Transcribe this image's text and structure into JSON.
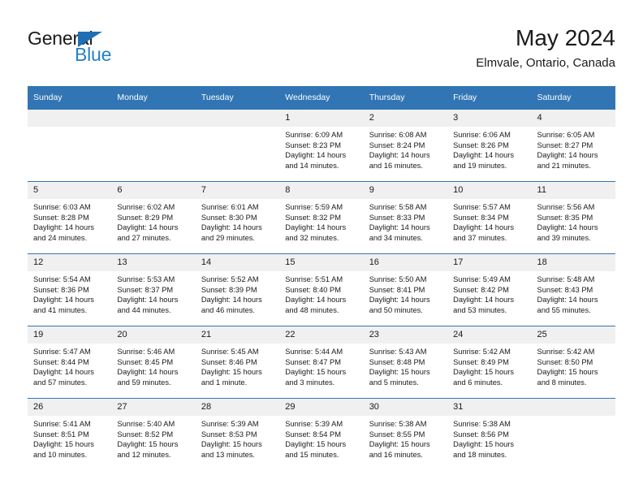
{
  "brand": {
    "name_top": "General",
    "name_bottom": "Blue",
    "accent_color": "#2480c8",
    "triangle_color": "#1f6fb5"
  },
  "header": {
    "title": "May 2024",
    "subtitle": "Elmvale, Ontario, Canada"
  },
  "calendar": {
    "header_bg": "#3175b4",
    "daynum_bg": "#f0f0f0",
    "weekday_headers": [
      "Sunday",
      "Monday",
      "Tuesday",
      "Wednesday",
      "Thursday",
      "Friday",
      "Saturday"
    ],
    "weeks": [
      [
        {
          "empty": true
        },
        {
          "empty": true
        },
        {
          "empty": true
        },
        {
          "day": "1",
          "sunrise": "Sunrise: 6:09 AM",
          "sunset": "Sunset: 8:23 PM",
          "daylight_line1": "Daylight: 14 hours",
          "daylight_line2": "and 14 minutes."
        },
        {
          "day": "2",
          "sunrise": "Sunrise: 6:08 AM",
          "sunset": "Sunset: 8:24 PM",
          "daylight_line1": "Daylight: 14 hours",
          "daylight_line2": "and 16 minutes."
        },
        {
          "day": "3",
          "sunrise": "Sunrise: 6:06 AM",
          "sunset": "Sunset: 8:26 PM",
          "daylight_line1": "Daylight: 14 hours",
          "daylight_line2": "and 19 minutes."
        },
        {
          "day": "4",
          "sunrise": "Sunrise: 6:05 AM",
          "sunset": "Sunset: 8:27 PM",
          "daylight_line1": "Daylight: 14 hours",
          "daylight_line2": "and 21 minutes."
        }
      ],
      [
        {
          "day": "5",
          "sunrise": "Sunrise: 6:03 AM",
          "sunset": "Sunset: 8:28 PM",
          "daylight_line1": "Daylight: 14 hours",
          "daylight_line2": "and 24 minutes."
        },
        {
          "day": "6",
          "sunrise": "Sunrise: 6:02 AM",
          "sunset": "Sunset: 8:29 PM",
          "daylight_line1": "Daylight: 14 hours",
          "daylight_line2": "and 27 minutes."
        },
        {
          "day": "7",
          "sunrise": "Sunrise: 6:01 AM",
          "sunset": "Sunset: 8:30 PM",
          "daylight_line1": "Daylight: 14 hours",
          "daylight_line2": "and 29 minutes."
        },
        {
          "day": "8",
          "sunrise": "Sunrise: 5:59 AM",
          "sunset": "Sunset: 8:32 PM",
          "daylight_line1": "Daylight: 14 hours",
          "daylight_line2": "and 32 minutes."
        },
        {
          "day": "9",
          "sunrise": "Sunrise: 5:58 AM",
          "sunset": "Sunset: 8:33 PM",
          "daylight_line1": "Daylight: 14 hours",
          "daylight_line2": "and 34 minutes."
        },
        {
          "day": "10",
          "sunrise": "Sunrise: 5:57 AM",
          "sunset": "Sunset: 8:34 PM",
          "daylight_line1": "Daylight: 14 hours",
          "daylight_line2": "and 37 minutes."
        },
        {
          "day": "11",
          "sunrise": "Sunrise: 5:56 AM",
          "sunset": "Sunset: 8:35 PM",
          "daylight_line1": "Daylight: 14 hours",
          "daylight_line2": "and 39 minutes."
        }
      ],
      [
        {
          "day": "12",
          "sunrise": "Sunrise: 5:54 AM",
          "sunset": "Sunset: 8:36 PM",
          "daylight_line1": "Daylight: 14 hours",
          "daylight_line2": "and 41 minutes."
        },
        {
          "day": "13",
          "sunrise": "Sunrise: 5:53 AM",
          "sunset": "Sunset: 8:37 PM",
          "daylight_line1": "Daylight: 14 hours",
          "daylight_line2": "and 44 minutes."
        },
        {
          "day": "14",
          "sunrise": "Sunrise: 5:52 AM",
          "sunset": "Sunset: 8:39 PM",
          "daylight_line1": "Daylight: 14 hours",
          "daylight_line2": "and 46 minutes."
        },
        {
          "day": "15",
          "sunrise": "Sunrise: 5:51 AM",
          "sunset": "Sunset: 8:40 PM",
          "daylight_line1": "Daylight: 14 hours",
          "daylight_line2": "and 48 minutes."
        },
        {
          "day": "16",
          "sunrise": "Sunrise: 5:50 AM",
          "sunset": "Sunset: 8:41 PM",
          "daylight_line1": "Daylight: 14 hours",
          "daylight_line2": "and 50 minutes."
        },
        {
          "day": "17",
          "sunrise": "Sunrise: 5:49 AM",
          "sunset": "Sunset: 8:42 PM",
          "daylight_line1": "Daylight: 14 hours",
          "daylight_line2": "and 53 minutes."
        },
        {
          "day": "18",
          "sunrise": "Sunrise: 5:48 AM",
          "sunset": "Sunset: 8:43 PM",
          "daylight_line1": "Daylight: 14 hours",
          "daylight_line2": "and 55 minutes."
        }
      ],
      [
        {
          "day": "19",
          "sunrise": "Sunrise: 5:47 AM",
          "sunset": "Sunset: 8:44 PM",
          "daylight_line1": "Daylight: 14 hours",
          "daylight_line2": "and 57 minutes."
        },
        {
          "day": "20",
          "sunrise": "Sunrise: 5:46 AM",
          "sunset": "Sunset: 8:45 PM",
          "daylight_line1": "Daylight: 14 hours",
          "daylight_line2": "and 59 minutes."
        },
        {
          "day": "21",
          "sunrise": "Sunrise: 5:45 AM",
          "sunset": "Sunset: 8:46 PM",
          "daylight_line1": "Daylight: 15 hours",
          "daylight_line2": "and 1 minute."
        },
        {
          "day": "22",
          "sunrise": "Sunrise: 5:44 AM",
          "sunset": "Sunset: 8:47 PM",
          "daylight_line1": "Daylight: 15 hours",
          "daylight_line2": "and 3 minutes."
        },
        {
          "day": "23",
          "sunrise": "Sunrise: 5:43 AM",
          "sunset": "Sunset: 8:48 PM",
          "daylight_line1": "Daylight: 15 hours",
          "daylight_line2": "and 5 minutes."
        },
        {
          "day": "24",
          "sunrise": "Sunrise: 5:42 AM",
          "sunset": "Sunset: 8:49 PM",
          "daylight_line1": "Daylight: 15 hours",
          "daylight_line2": "and 6 minutes."
        },
        {
          "day": "25",
          "sunrise": "Sunrise: 5:42 AM",
          "sunset": "Sunset: 8:50 PM",
          "daylight_line1": "Daylight: 15 hours",
          "daylight_line2": "and 8 minutes."
        }
      ],
      [
        {
          "day": "26",
          "sunrise": "Sunrise: 5:41 AM",
          "sunset": "Sunset: 8:51 PM",
          "daylight_line1": "Daylight: 15 hours",
          "daylight_line2": "and 10 minutes."
        },
        {
          "day": "27",
          "sunrise": "Sunrise: 5:40 AM",
          "sunset": "Sunset: 8:52 PM",
          "daylight_line1": "Daylight: 15 hours",
          "daylight_line2": "and 12 minutes."
        },
        {
          "day": "28",
          "sunrise": "Sunrise: 5:39 AM",
          "sunset": "Sunset: 8:53 PM",
          "daylight_line1": "Daylight: 15 hours",
          "daylight_line2": "and 13 minutes."
        },
        {
          "day": "29",
          "sunrise": "Sunrise: 5:39 AM",
          "sunset": "Sunset: 8:54 PM",
          "daylight_line1": "Daylight: 15 hours",
          "daylight_line2": "and 15 minutes."
        },
        {
          "day": "30",
          "sunrise": "Sunrise: 5:38 AM",
          "sunset": "Sunset: 8:55 PM",
          "daylight_line1": "Daylight: 15 hours",
          "daylight_line2": "and 16 minutes."
        },
        {
          "day": "31",
          "sunrise": "Sunrise: 5:38 AM",
          "sunset": "Sunset: 8:56 PM",
          "daylight_line1": "Daylight: 15 hours",
          "daylight_line2": "and 18 minutes."
        },
        {
          "empty": true
        }
      ]
    ]
  }
}
